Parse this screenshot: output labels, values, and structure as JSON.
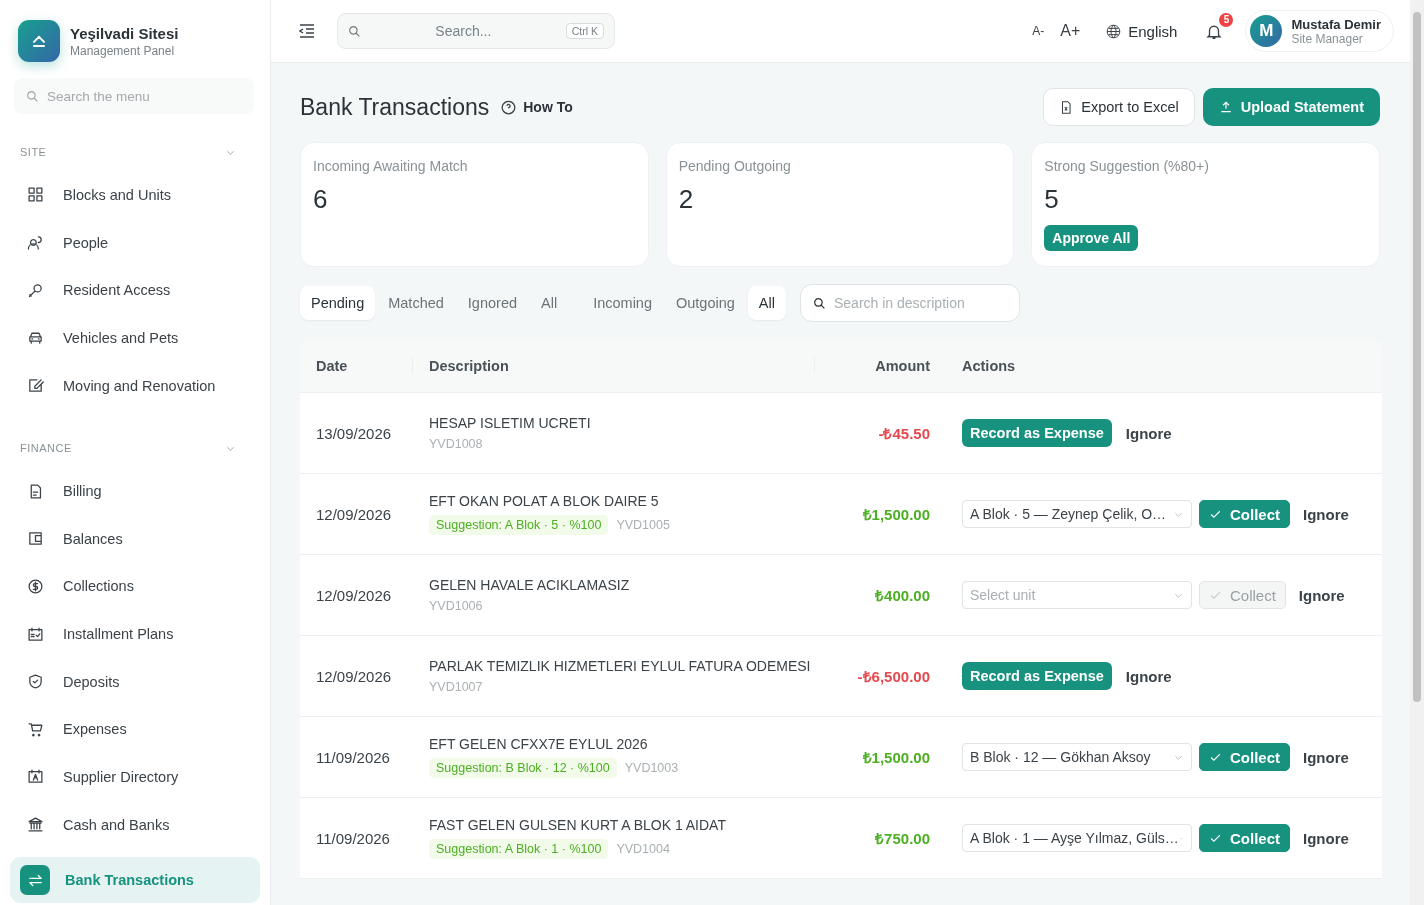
{
  "brand": {
    "title": "Yeşilvadi Sitesi",
    "subtitle": "Management Panel"
  },
  "menu_search": {
    "placeholder": "Search the menu"
  },
  "sidebar": [
    {
      "label": "SITE",
      "expanded": true,
      "items": [
        {
          "label": "Blocks and Units",
          "selected": false
        },
        {
          "label": "People",
          "selected": false
        },
        {
          "label": "Resident Access",
          "selected": false
        },
        {
          "label": "Vehicles and Pets",
          "selected": false
        },
        {
          "label": "Moving and Renovation",
          "selected": false
        }
      ]
    },
    {
      "label": "FINANCE",
      "expanded": true,
      "items": [
        {
          "label": "Billing",
          "selected": false
        },
        {
          "label": "Balances",
          "selected": false
        },
        {
          "label": "Collections",
          "selected": false
        },
        {
          "label": "Installment Plans",
          "selected": false
        },
        {
          "label": "Deposits",
          "selected": false
        },
        {
          "label": "Expenses",
          "selected": false
        },
        {
          "label": "Supplier Directory",
          "selected": false
        },
        {
          "label": "Cash and Banks",
          "selected": false
        },
        {
          "label": "Bank Transactions",
          "selected": true
        }
      ]
    }
  ],
  "topbar": {
    "search": {
      "placeholder": "Search...",
      "shortcut": "Ctrl K"
    },
    "font_smaller": "A-",
    "font_larger": "A+",
    "language": "English",
    "notifications": "5",
    "user": {
      "initial": "M",
      "name": "Mustafa Demir",
      "role": "Site Manager"
    }
  },
  "page": {
    "title": "Bank Transactions",
    "help": "How To",
    "export": "Export to Excel",
    "upload": "Upload Statement"
  },
  "stats": [
    {
      "label": "Incoming Awaiting Match",
      "value": "6"
    },
    {
      "label": "Pending Outgoing",
      "value": "2"
    },
    {
      "label": "Strong Suggestion (%80+)",
      "value": "5",
      "action": "Approve All"
    }
  ],
  "status_tabs": [
    {
      "label": "Pending",
      "selected": true
    },
    {
      "label": "Matched",
      "selected": false
    },
    {
      "label": "Ignored",
      "selected": false
    },
    {
      "label": "All",
      "selected": false
    }
  ],
  "direction_tabs": [
    {
      "label": "Incoming",
      "selected": false
    },
    {
      "label": "Outgoing",
      "selected": false
    },
    {
      "label": "All",
      "selected": true
    }
  ],
  "description_search": {
    "placeholder": "Search in description"
  },
  "table": {
    "columns": [
      "Date",
      "Description",
      "Amount",
      "Actions"
    ],
    "rows": [
      {
        "kind": "expense",
        "date": "13/09/2026",
        "description": "HESAP ISLETIM UCRETI",
        "reference": "YVD1008",
        "amount": "-₺45.50",
        "action": "Record as Expense",
        "ignore": "Ignore"
      },
      {
        "kind": "income",
        "date": "12/09/2026",
        "description": "EFT OKAN POLAT A BLOK DAIRE 5",
        "suggestion": "Suggestion: A Blok · 5 · %100",
        "reference": "YVD1005",
        "amount": "₺1,500.00",
        "unit": "A Blok · 5 — Zeynep Çelik, O…",
        "collect": "Collect",
        "disabled": false,
        "ignore": "Ignore"
      },
      {
        "kind": "income",
        "date": "12/09/2026",
        "description": "GELEN HAVALE ACIKLAMASIZ",
        "reference": "YVD1006",
        "amount": "₺400.00",
        "unit_placeholder": "Select unit",
        "collect": "Collect",
        "disabled": true,
        "ignore": "Ignore"
      },
      {
        "kind": "expense",
        "date": "12/09/2026",
        "description": "PARLAK TEMIZLIK HIZMETLERI EYLUL FATURA ODEMESI",
        "reference": "YVD1007",
        "amount": "-₺6,500.00",
        "action": "Record as Expense",
        "ignore": "Ignore"
      },
      {
        "kind": "income",
        "date": "11/09/2026",
        "description": "EFT GELEN CFXX7E EYLUL 2026",
        "suggestion": "Suggestion: B Blok · 12 · %100",
        "reference": "YVD1003",
        "amount": "₺1,500.00",
        "unit": "B Blok · 12 — Gökhan Aksoy",
        "collect": "Collect",
        "disabled": false,
        "ignore": "Ignore"
      },
      {
        "kind": "income",
        "date": "11/09/2026",
        "description": "FAST GELEN GULSEN KURT A BLOK 1 AIDAT",
        "suggestion": "Suggestion: A Blok · 1 · %100",
        "reference": "YVD1004",
        "amount": "₺750.00",
        "unit": "A Blok · 1 — Ayşe Yılmaz, Güls…",
        "collect": "Collect",
        "disabled": false,
        "ignore": "Ignore"
      }
    ]
  }
}
